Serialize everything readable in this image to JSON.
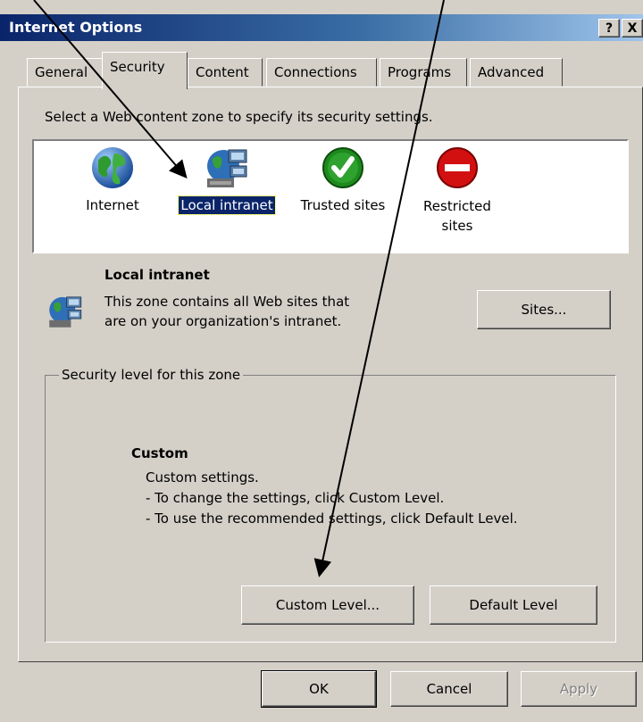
{
  "window": {
    "title": "Internet Options",
    "help_label": "?",
    "close_label": "X"
  },
  "tabs": [
    {
      "label": "General",
      "active": false
    },
    {
      "label": "Security",
      "active": true
    },
    {
      "label": "Content",
      "active": false
    },
    {
      "label": "Connections",
      "active": false
    },
    {
      "label": "Programs",
      "active": false
    },
    {
      "label": "Advanced",
      "active": false
    }
  ],
  "security": {
    "instruction": "Select a Web content zone to specify its security settings.",
    "zones": [
      {
        "label": "Internet",
        "icon": "globe-icon",
        "selected": false
      },
      {
        "label": "Local intranet",
        "icon": "intranet-icon",
        "selected": true
      },
      {
        "label": "Trusted sites",
        "icon": "checkmark-icon",
        "selected": false
      },
      {
        "label_line1": "Restricted",
        "label_line2": "sites",
        "icon": "no-entry-icon",
        "selected": false
      }
    ],
    "zone_info": {
      "title": "Local intranet",
      "line1": "This zone contains all Web sites that",
      "line2": "are on your organization's intranet.",
      "sites_button": "Sites..."
    },
    "level_group": {
      "legend": "Security level for this zone",
      "level_name": "Custom",
      "desc1": "Custom settings.",
      "desc2": "- To change the settings, click Custom Level.",
      "desc3": "- To use the recommended settings, click Default Level.",
      "custom_button": "Custom Level...",
      "default_button": "Default Level"
    }
  },
  "footer": {
    "ok": "OK",
    "cancel": "Cancel",
    "apply": "Apply",
    "apply_enabled": false
  },
  "colors": {
    "title_gradient_start": "#0a246a",
    "title_gradient_end": "#a6caf0",
    "dialog_face": "#d4d0c8",
    "selection": "#0a246a"
  }
}
